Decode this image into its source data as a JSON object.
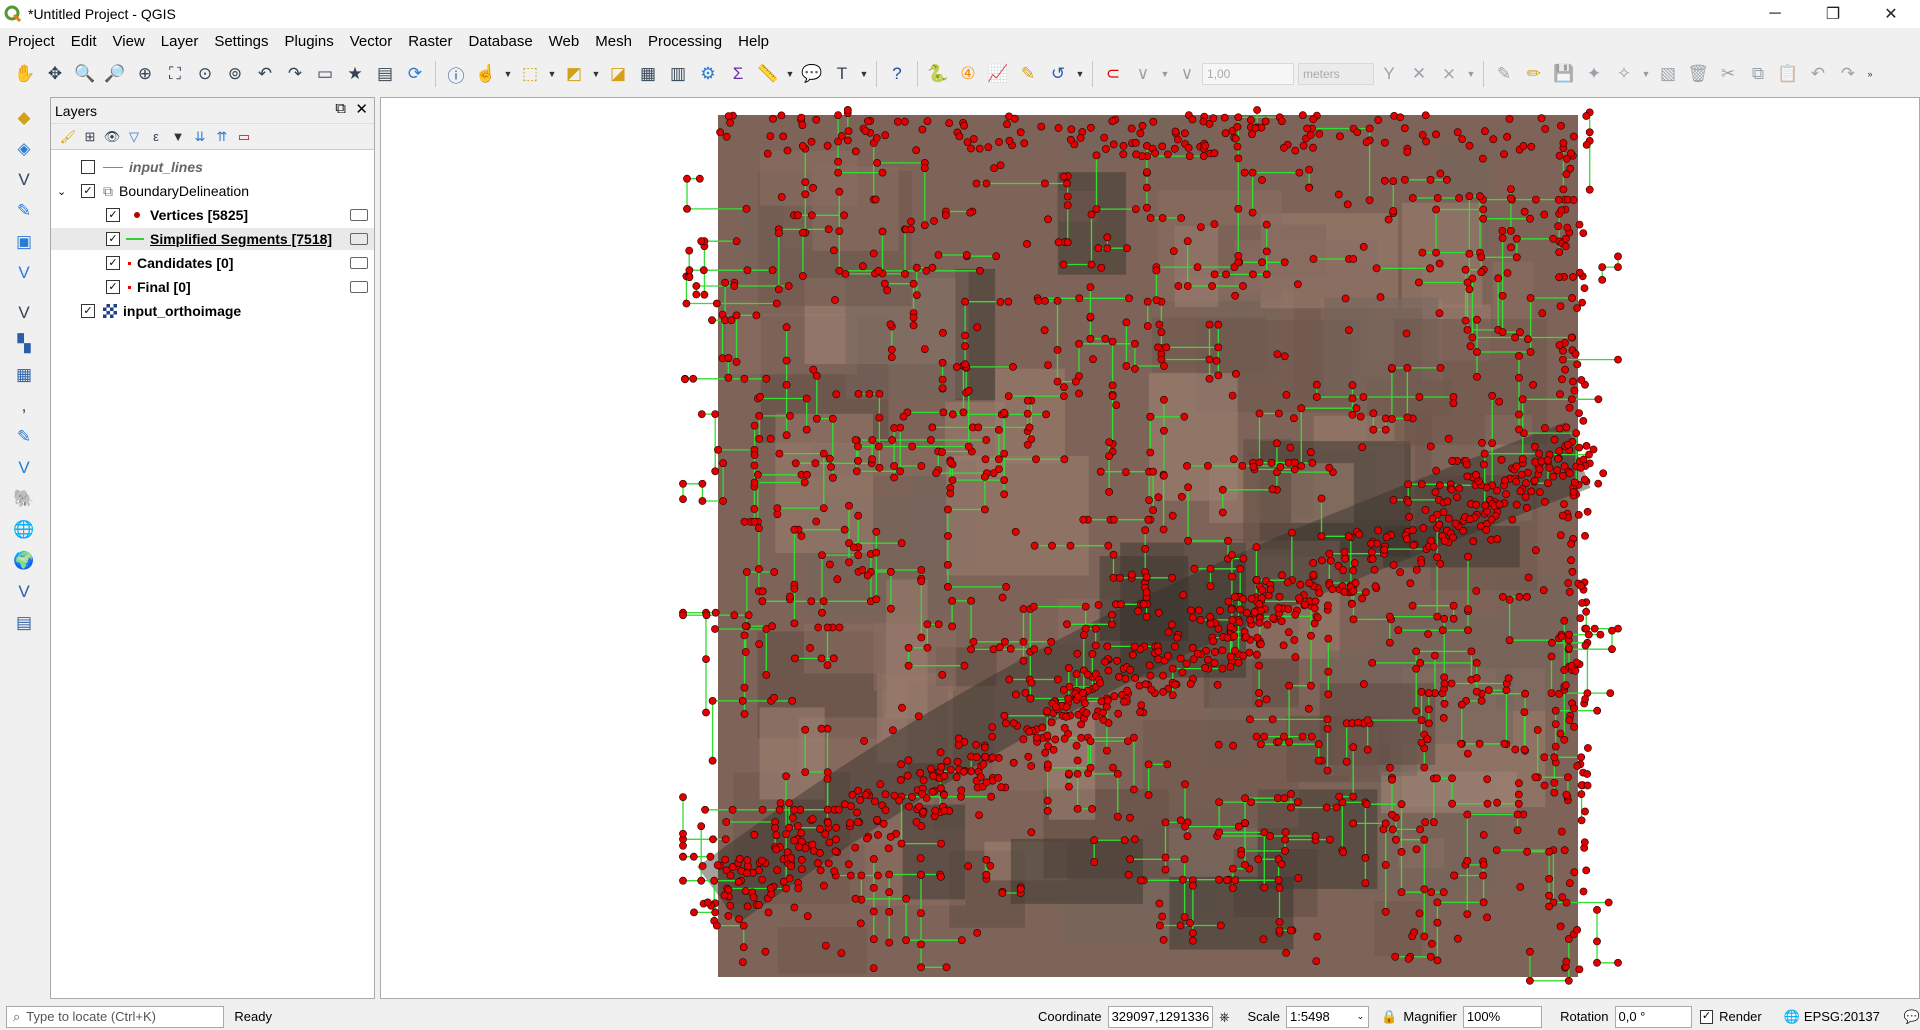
{
  "window": {
    "title": "*Untitled Project - QGIS"
  },
  "menubar": [
    "Project",
    "Edit",
    "View",
    "Layer",
    "Settings",
    "Plugins",
    "Vector",
    "Raster",
    "Database",
    "Web",
    "Mesh",
    "Processing",
    "Help"
  ],
  "toolbar": {
    "stroke_width_value": "1,00",
    "units_value": "meters"
  },
  "layers_panel": {
    "title": "Layers",
    "items": [
      {
        "label": "input_lines",
        "checked": false
      },
      {
        "label": "BoundaryDelineation",
        "checked": true
      },
      {
        "label": "Vertices [5825]",
        "checked": true
      },
      {
        "label": "Simplified Segments [7518]",
        "checked": true
      },
      {
        "label": "Candidates [0]",
        "checked": true
      },
      {
        "label": "Final [0]",
        "checked": true
      },
      {
        "label": "input_orthoimage",
        "checked": true
      }
    ]
  },
  "status": {
    "locate_placeholder": "Type to locate (Ctrl+K)",
    "message": "Ready",
    "coordinate_label": "Coordinate",
    "coordinate_value": "329097,1291336",
    "scale_label": "Scale",
    "scale_value": "1:5498",
    "magnifier_label": "Magnifier",
    "magnifier_value": "100%",
    "rotation_label": "Rotation",
    "rotation_value": "0,0 °",
    "render_label": "Render",
    "crs_value": "EPSG:20137"
  },
  "colors": {
    "vertex_red": "#e00000",
    "segment_green": "#33dd33",
    "ortho_base": "#7e6458"
  }
}
